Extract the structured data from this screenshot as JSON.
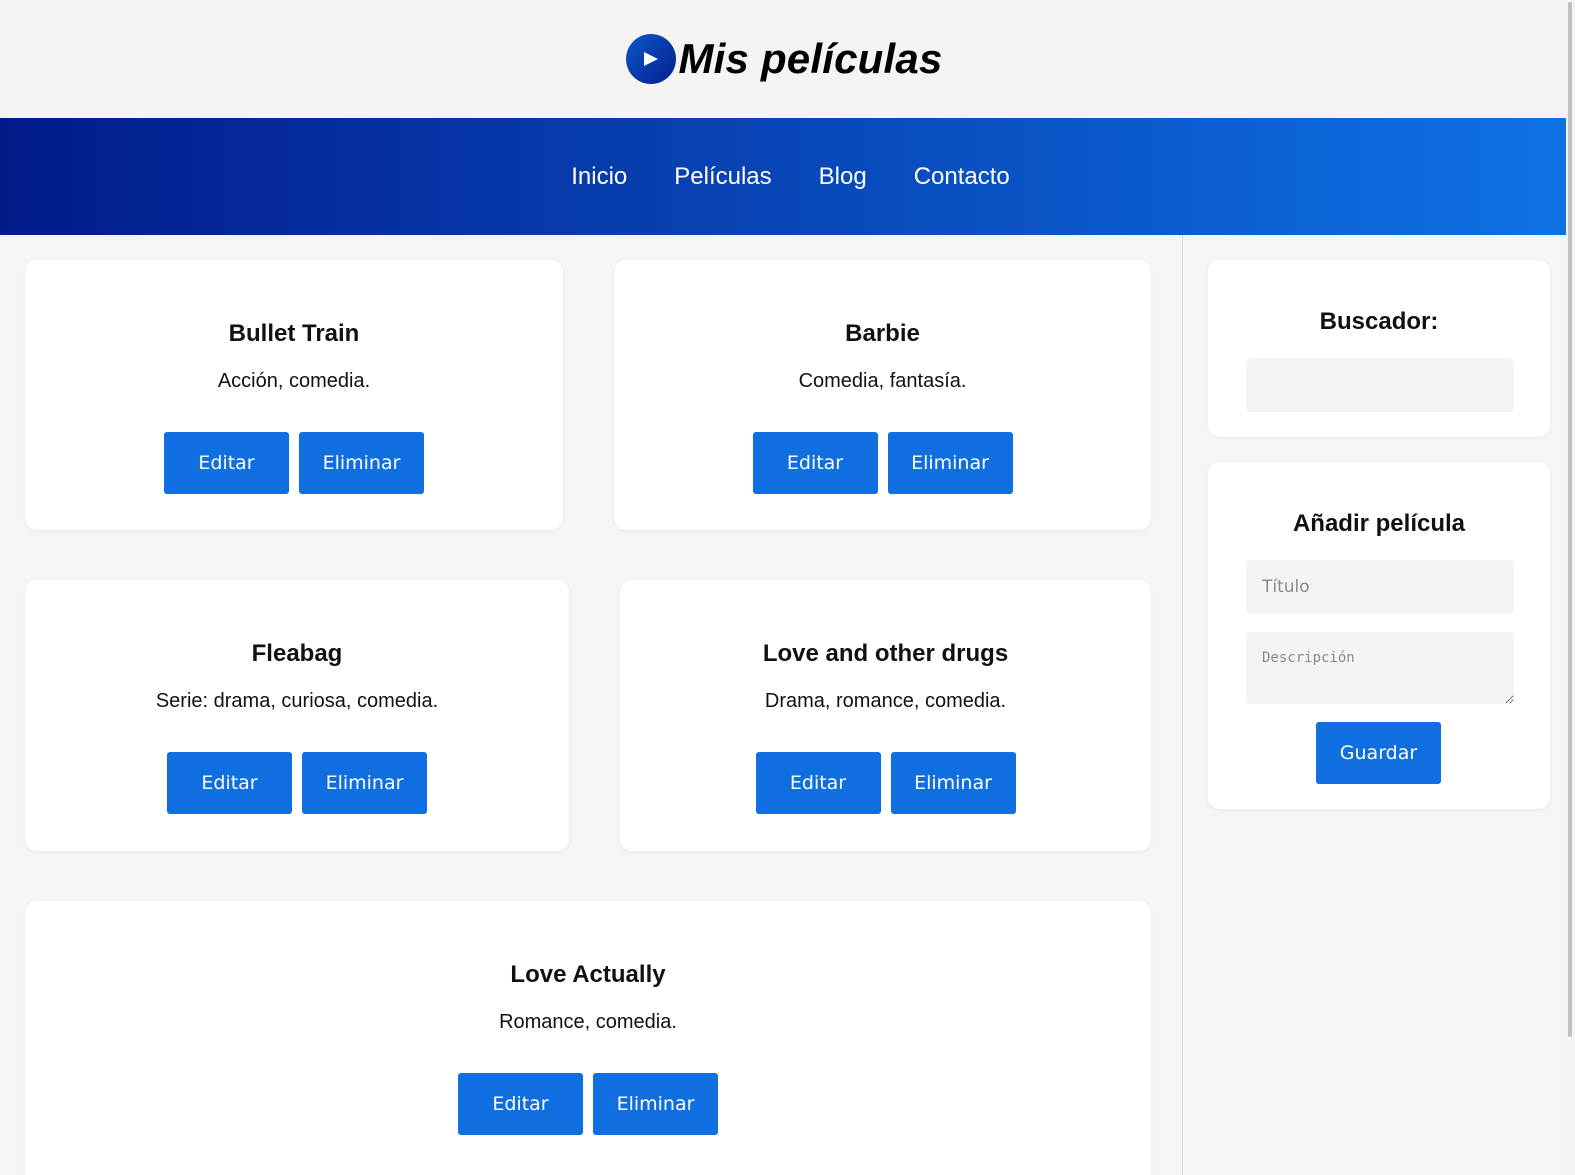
{
  "header": {
    "title": "Mis películas",
    "logo_icon": "play-icon"
  },
  "nav": {
    "items": [
      {
        "label": "Inicio"
      },
      {
        "label": "Películas"
      },
      {
        "label": "Blog"
      },
      {
        "label": "Contacto"
      }
    ]
  },
  "movies": [
    {
      "title": "Bullet Train",
      "description": "Acción, comedia.",
      "edit_label": "Editar",
      "delete_label": "Eliminar"
    },
    {
      "title": "Barbie",
      "description": "Comedia, fantasía.",
      "edit_label": "Editar",
      "delete_label": "Eliminar"
    },
    {
      "title": "Fleabag",
      "description": "Serie: drama, curiosa, comedia.",
      "edit_label": "Editar",
      "delete_label": "Eliminar"
    },
    {
      "title": "Love and other drugs",
      "description": "Drama, romance, comedia.",
      "edit_label": "Editar",
      "delete_label": "Eliminar"
    },
    {
      "title": "Love Actually",
      "description": "Romance, comedia.",
      "edit_label": "Editar",
      "delete_label": "Eliminar"
    }
  ],
  "sidebar": {
    "search": {
      "title": "Buscador:",
      "value": "",
      "placeholder": ""
    },
    "add_movie": {
      "title": "Añadir película",
      "title_placeholder": "Título",
      "description_placeholder": "Descripción",
      "save_label": "Guardar"
    }
  },
  "colors": {
    "accent": "#0f6fe0",
    "nav_gradient_start": "#021b8a",
    "nav_gradient_end": "#0e73e6",
    "background": "#f4f5f7"
  }
}
